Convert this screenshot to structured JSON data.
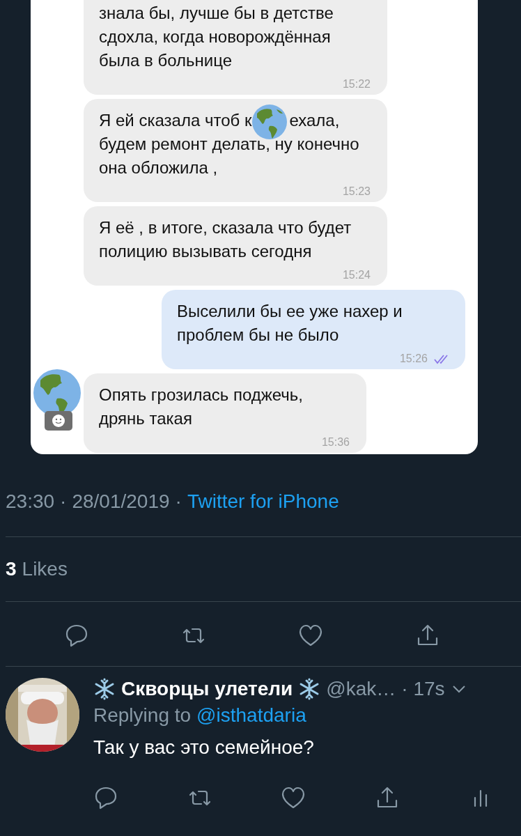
{
  "chat": {
    "messages": [
      {
        "kind": "incoming",
        "text": "знала бы, лучше бы в детстве сдохла, когда новорождённая была в больнице",
        "time": "15:22",
        "cut_top": true
      },
      {
        "kind": "incoming",
        "text": "Я ей сказала чтоб к",
        "text_after": "ехала, будем ремонт делать, ну конечно она обложила ,",
        "time": "15:23"
      },
      {
        "kind": "incoming",
        "text": "Я её , в итоге, сказала что будет полицию вызывать сегодня",
        "time": "15:24"
      },
      {
        "kind": "outgoing",
        "text": "Выселили бы ее уже нахер и проблем бы не было",
        "time": "15:26",
        "read": true
      },
      {
        "kind": "incoming",
        "text": "Опять грозилась поджечь, дрянь такая",
        "time": "15:36",
        "avatar": true
      }
    ]
  },
  "tweet_meta": {
    "time": "23:30",
    "separator_1": "·",
    "date": "28/01/2019",
    "separator_2": "·",
    "source": "Twitter for iPhone"
  },
  "likes": {
    "count": "3",
    "label": "Likes"
  },
  "reply": {
    "name": "Скворцы улетели",
    "handle": "@kak…",
    "time": "· 17s",
    "replying_label": "Replying to",
    "replying_to": "@isthatdaria",
    "text": "Так у вас это семейное?"
  }
}
